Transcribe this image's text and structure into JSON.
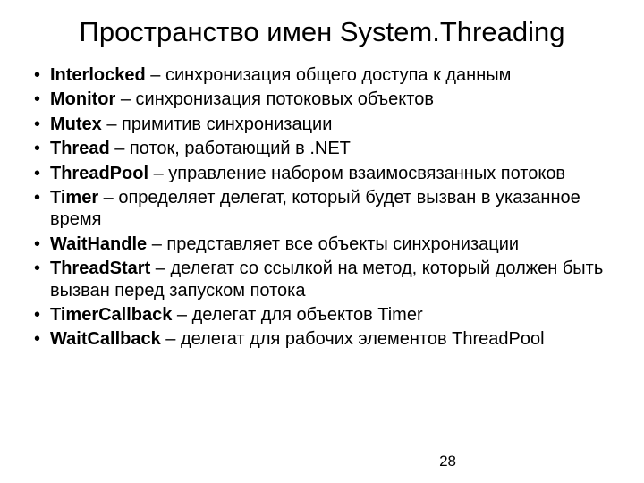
{
  "title": "Пространство имен System.Threading",
  "items": [
    {
      "term": "Interlocked",
      "desc": " – синхронизация общего доступа к данным"
    },
    {
      "term": "Monitor",
      "desc": " – синхронизация потоковых объектов"
    },
    {
      "term": "Mutex",
      "desc": " – примитив синхронизации"
    },
    {
      "term": "Thread",
      "desc": " – поток, работающий в .NET"
    },
    {
      "term": "ThreadPool",
      "desc": " – управление набором взаимосвязанных потоков"
    },
    {
      "term": "Timer",
      "desc": " – определяет делегат, который будет вызван в указанное время"
    },
    {
      "term": "WaitHandle",
      "desc": " – представляет все объекты синхронизации"
    },
    {
      "term": "ThreadStart",
      "desc": " – делегат со ссылкой на метод, который должен быть вызван перед запуском потока"
    },
    {
      "term": "TimerCallback",
      "desc": " – делегат для объектов Timer"
    },
    {
      "term": "WaitCallback",
      "desc": " – делегат для рабочих элементов ThreadPool"
    }
  ],
  "pageNumber": "28"
}
